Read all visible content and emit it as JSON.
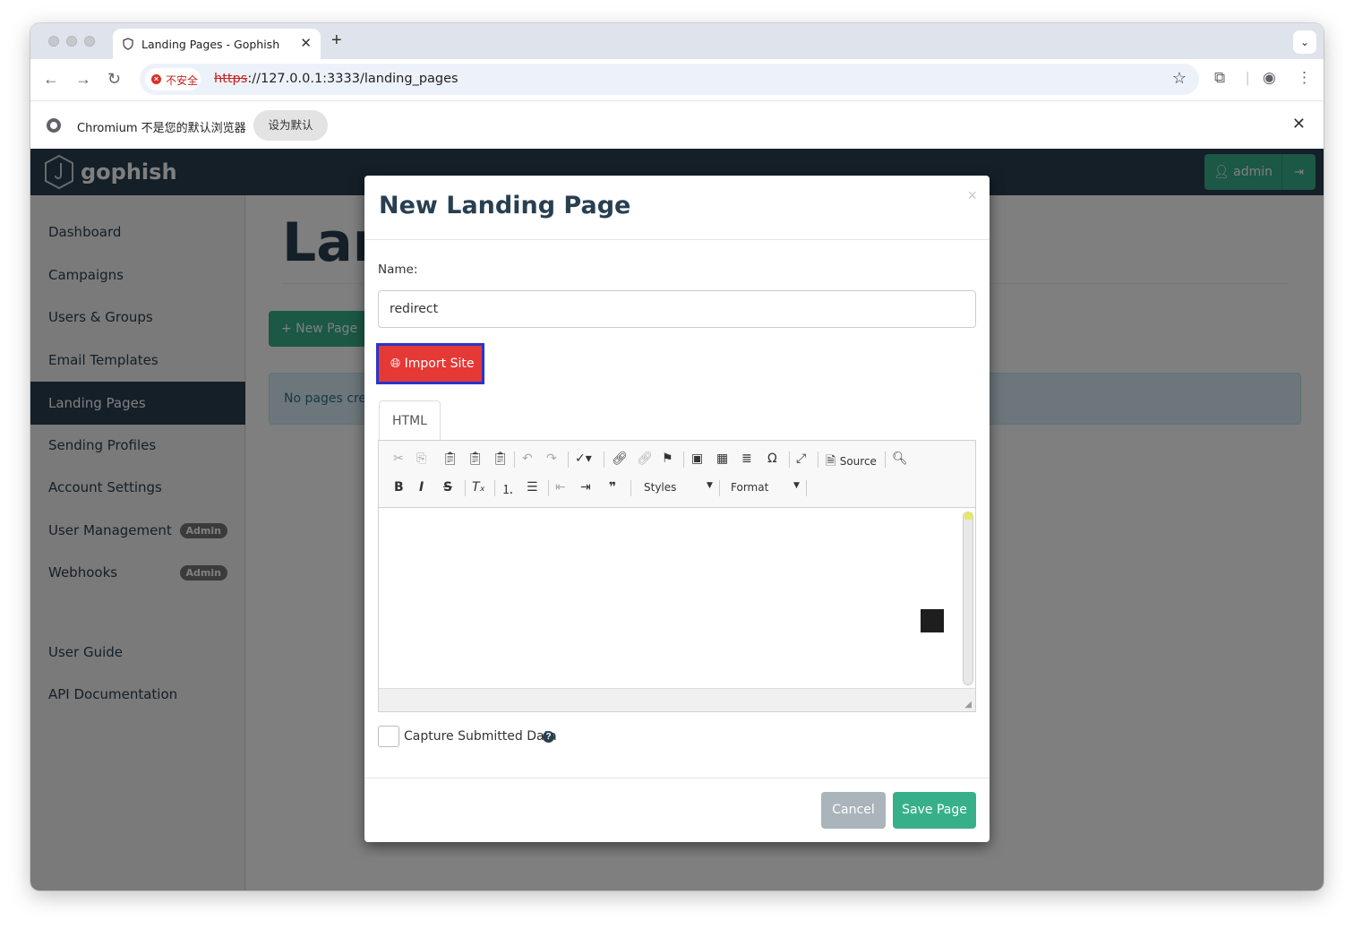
{
  "browser": {
    "tab_title": "Landing Pages - Gophish",
    "tab_close": "✕",
    "new_tab": "+",
    "tab_menu": "⌄",
    "insecure_label": "不安全",
    "url_scheme": "https",
    "url_rest": "://127.0.0.1:3333/landing_pages",
    "infobar_text": "Chromium 不是您的默认浏览器",
    "infobar_button": "设为默认",
    "infobar_close": "✕"
  },
  "navbar": {
    "brand": "gophish",
    "user": "admin",
    "user_icon": "user-icon",
    "logout_icon": "logout-icon"
  },
  "sidebar": {
    "items": [
      {
        "label": "Dashboard"
      },
      {
        "label": "Campaigns"
      },
      {
        "label": "Users & Groups"
      },
      {
        "label": "Email Templates"
      },
      {
        "label": "Landing Pages",
        "active": true
      },
      {
        "label": "Sending Profiles"
      },
      {
        "label": "Account Settings"
      },
      {
        "label": "User Management",
        "badge": "Admin"
      },
      {
        "label": "Webhooks",
        "badge": "Admin"
      },
      {
        "label": "User Guide"
      },
      {
        "label": "API Documentation"
      }
    ]
  },
  "main": {
    "heading": "Lan",
    "new_page_button": "+ New Page",
    "alert_text": "No pages crea"
  },
  "modal": {
    "title": "New Landing Page",
    "close": "×",
    "name_label": "Name:",
    "name_value": "redirect",
    "import_button": "Import Site",
    "tab_html": "HTML",
    "toolbar": {
      "source_label": "Source",
      "styles_label": "Styles",
      "format_label": "Format"
    },
    "capture_label": "Capture Submitted Data",
    "cancel_button": "Cancel",
    "save_button": "Save Page"
  },
  "colors": {
    "navbar": "#283f50",
    "accent": "#37b08a",
    "import_button": "#e53935",
    "import_outline": "#2935c8"
  }
}
